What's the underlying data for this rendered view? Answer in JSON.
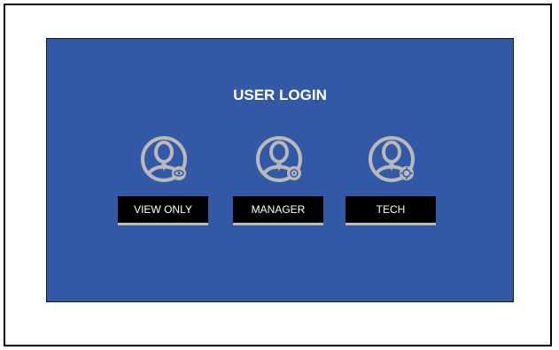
{
  "login": {
    "title": "USER LOGIN",
    "users": [
      {
        "label": "VIEW ONLY",
        "icon": "user-eye-icon"
      },
      {
        "label": "MANAGER",
        "icon": "user-gear-icon"
      },
      {
        "label": "TECH",
        "icon": "user-gear-icon"
      }
    ]
  },
  "colors": {
    "panel_background": "#3258a6",
    "button_background": "#000000",
    "button_text": "#ffffff",
    "icon": "#b9b9b9"
  }
}
